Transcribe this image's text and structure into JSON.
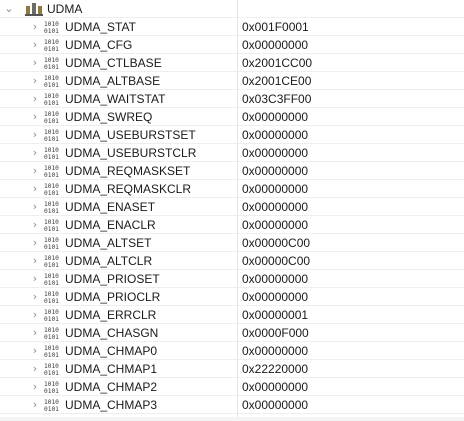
{
  "peripheral": {
    "name": "UDMA",
    "icon": "register-group-icon",
    "expanded": true
  },
  "registers": [
    {
      "name": "UDMA_STAT",
      "value": "0x001F0001"
    },
    {
      "name": "UDMA_CFG",
      "value": "0x00000000"
    },
    {
      "name": "UDMA_CTLBASE",
      "value": "0x2001CC00"
    },
    {
      "name": "UDMA_ALTBASE",
      "value": "0x2001CE00"
    },
    {
      "name": "UDMA_WAITSTAT",
      "value": "0x03C3FF00"
    },
    {
      "name": "UDMA_SWREQ",
      "value": "0x00000000"
    },
    {
      "name": "UDMA_USEBURSTSET",
      "value": "0x00000000"
    },
    {
      "name": "UDMA_USEBURSTCLR",
      "value": "0x00000000"
    },
    {
      "name": "UDMA_REQMASKSET",
      "value": "0x00000000"
    },
    {
      "name": "UDMA_REQMASKCLR",
      "value": "0x00000000"
    },
    {
      "name": "UDMA_ENASET",
      "value": "0x00000000"
    },
    {
      "name": "UDMA_ENACLR",
      "value": "0x00000000"
    },
    {
      "name": "UDMA_ALTSET",
      "value": "0x00000C00"
    },
    {
      "name": "UDMA_ALTCLR",
      "value": "0x00000C00"
    },
    {
      "name": "UDMA_PRIOSET",
      "value": "0x00000000"
    },
    {
      "name": "UDMA_PRIOCLR",
      "value": "0x00000000"
    },
    {
      "name": "UDMA_ERRCLR",
      "value": "0x00000001"
    },
    {
      "name": "UDMA_CHASGN",
      "value": "0x0000F000"
    },
    {
      "name": "UDMA_CHMAP0",
      "value": "0x00000000"
    },
    {
      "name": "UDMA_CHMAP1",
      "value": "0x22220000"
    },
    {
      "name": "UDMA_CHMAP2",
      "value": "0x00000000"
    },
    {
      "name": "UDMA_CHMAP3",
      "value": "0x00000000"
    }
  ],
  "icons": {
    "expand": "chevron-down-icon",
    "collapse": "chevron-right-icon",
    "register": "binary-register-icon"
  },
  "colors": {
    "text": "#1a1a1a",
    "chevron": "#8a8a8a",
    "icon_bits": "#3a3a3a",
    "group_icon": "#7a6a3a",
    "grid": "#eeeeee"
  }
}
